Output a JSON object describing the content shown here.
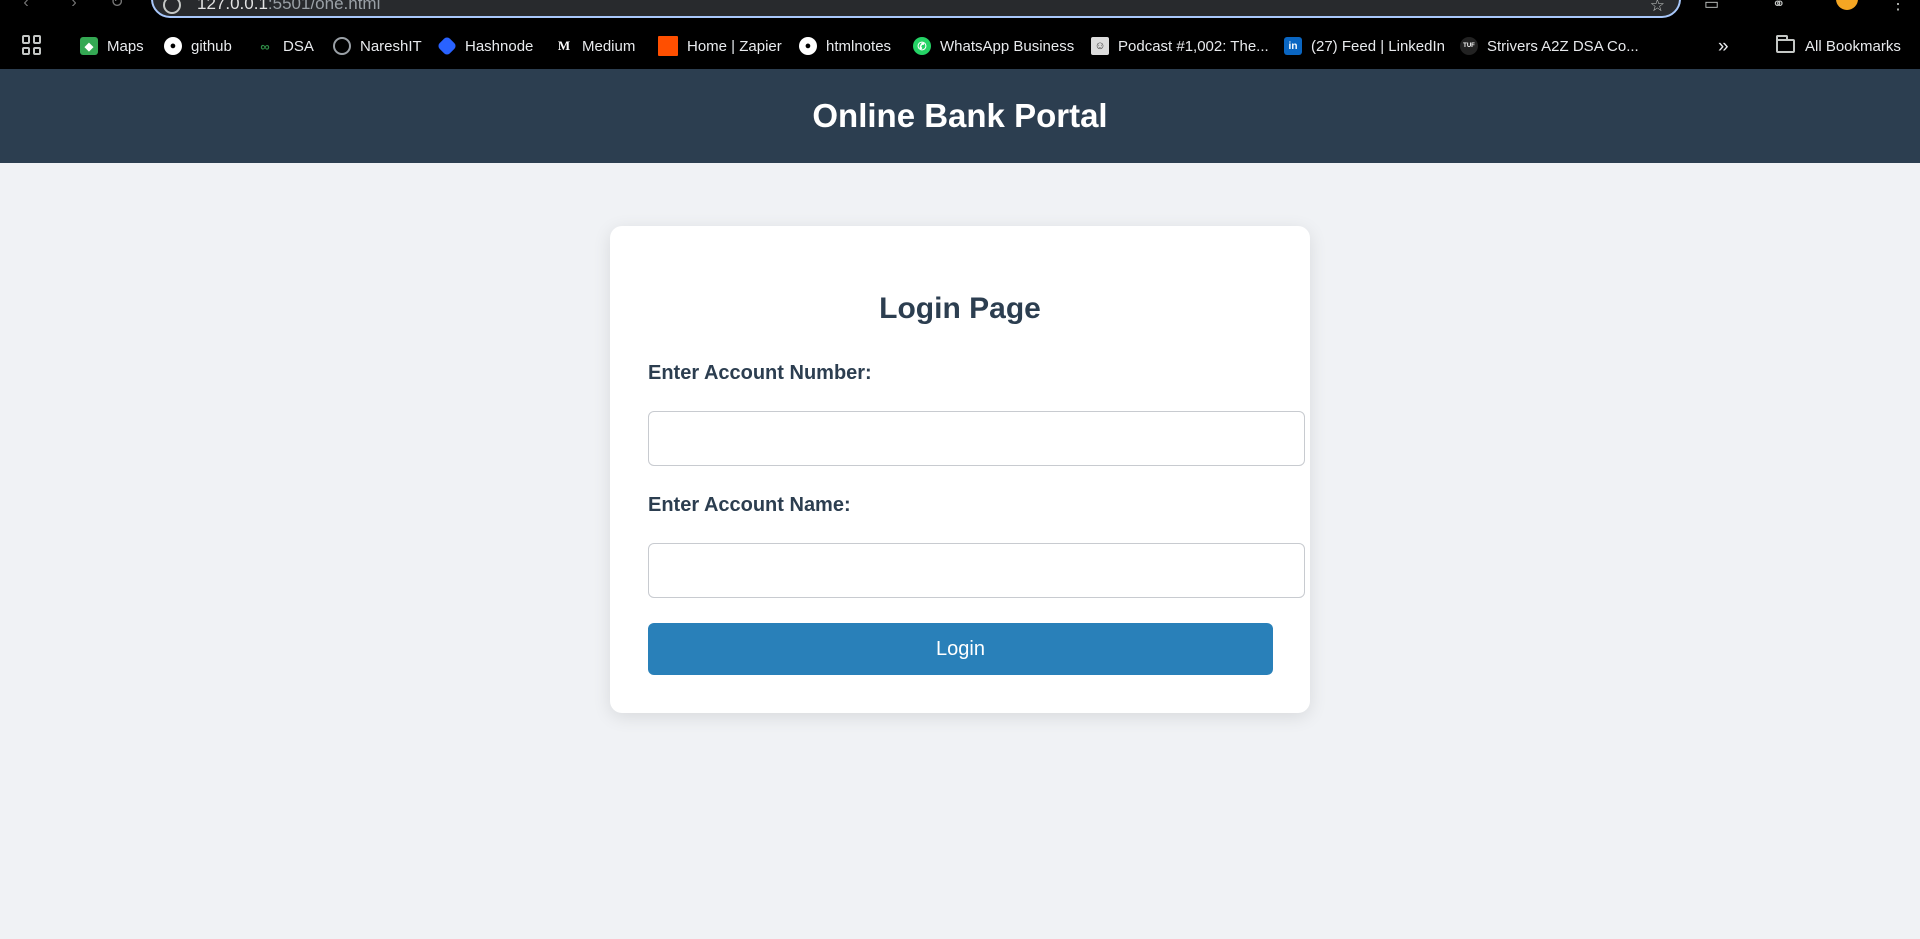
{
  "browser": {
    "url_host": "127.0.0.1",
    "url_path": ":5501/one.html"
  },
  "bookmarks": [
    {
      "label": "Maps",
      "icon": "maps-icon",
      "color": "#34a853"
    },
    {
      "label": "github",
      "icon": "github-icon",
      "color": "#ffffff"
    },
    {
      "label": "DSA",
      "icon": "geeksforgeeks-icon",
      "color": "#2f8d46"
    },
    {
      "label": "NareshIT",
      "icon": "globe-icon",
      "color": "#9aa0a6"
    },
    {
      "label": "Hashnode",
      "icon": "hashnode-icon",
      "color": "#2962ff"
    },
    {
      "label": "Medium",
      "icon": "medium-icon",
      "color": "#ffffff"
    },
    {
      "label": "Home | Zapier",
      "icon": "zapier-icon",
      "color": "#ff4f00"
    },
    {
      "label": "htmlnotes",
      "icon": "github-icon",
      "color": "#ffffff"
    },
    {
      "label": "WhatsApp Business",
      "icon": "whatsapp-icon",
      "color": "#25d366"
    },
    {
      "label": "Podcast #1,002: The...",
      "icon": "podcast-icon",
      "color": "#dddddd"
    },
    {
      "label": "(27) Feed | LinkedIn",
      "icon": "linkedin-icon",
      "color": "#0a66c2"
    },
    {
      "label": "Strivers A2Z DSA Co...",
      "icon": "tuf-icon",
      "color": "#222222"
    }
  ],
  "all_bookmarks_label": "All Bookmarks",
  "header": {
    "title": "Online Bank Portal"
  },
  "login": {
    "heading": "Login Page",
    "account_number_label": "Enter Account Number:",
    "account_number_value": "",
    "account_name_label": "Enter Account Name:",
    "account_name_value": "",
    "button_label": "Login"
  },
  "colors": {
    "header_bg": "#2c3e50",
    "accent": "#2980b9",
    "page_bg": "#f0f2f5"
  }
}
